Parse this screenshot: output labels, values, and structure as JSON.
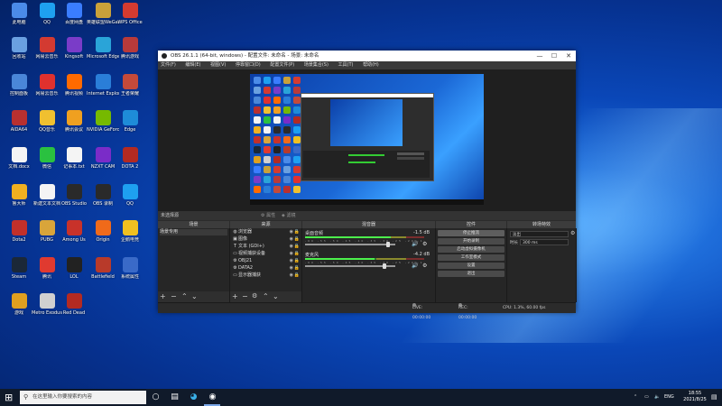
{
  "desktop": {
    "icons": [
      {
        "label": "此电脑",
        "color": "#4b8be8"
      },
      {
        "label": "QQ",
        "color": "#1ea0f0"
      },
      {
        "label": "百度网盘",
        "color": "#3a7dff"
      },
      {
        "label": "英雄联盟WeGame",
        "color": "#c9a13a"
      },
      {
        "label": "WPS Office",
        "color": "#d43b30"
      },
      {
        "label": "回收站",
        "color": "#6aa0e0"
      },
      {
        "label": "网易云音乐",
        "color": "#d33a31"
      },
      {
        "label": "Kingsoft",
        "color": "#7a3cc8"
      },
      {
        "label": "Microsoft Edge",
        "color": "#2aa4d8"
      },
      {
        "label": "腾讯游戏",
        "color": "#b83a3a"
      },
      {
        "label": "控制面板",
        "color": "#4a86d8"
      },
      {
        "label": "网易云音乐",
        "color": "#e0312e"
      },
      {
        "label": "腾讯视频",
        "color": "#ff6a00"
      },
      {
        "label": "Internet Explorer",
        "color": "#2a7ed8"
      },
      {
        "label": "王者荣耀",
        "color": "#c44a3a"
      },
      {
        "label": "AIDA64",
        "color": "#b83030"
      },
      {
        "label": "QQ音乐",
        "color": "#f0c030"
      },
      {
        "label": "腾讯会议",
        "color": "#f0a020"
      },
      {
        "label": "NVIDIA GeForce",
        "color": "#76b900"
      },
      {
        "label": "Edge",
        "color": "#1e8cd8"
      },
      {
        "label": "文档.docx",
        "color": "#f4f4f4"
      },
      {
        "label": "微信",
        "color": "#2ac140"
      },
      {
        "label": "记事本.txt",
        "color": "#f4f4f4"
      },
      {
        "label": "NZXT CAM",
        "color": "#7a2cc8"
      },
      {
        "label": "DOTA 2",
        "color": "#b32a22"
      },
      {
        "label": "鲁大师",
        "color": "#f0b020"
      },
      {
        "label": "新建文本文档",
        "color": "#f4f4f4"
      },
      {
        "label": "OBS Studio",
        "color": "#2a2a2a"
      },
      {
        "label": "OBS 录制",
        "color": "#2a2a2a"
      },
      {
        "label": "QQ",
        "color": "#1ea0f0"
      },
      {
        "label": "Dota2",
        "color": "#c2302a"
      },
      {
        "label": "PUBG",
        "color": "#d9a53a"
      },
      {
        "label": "Among Us",
        "color": "#c8322a"
      },
      {
        "label": "Origin",
        "color": "#f06a1a"
      },
      {
        "label": "企鹅电竞",
        "color": "#f0c020"
      },
      {
        "label": "Steam",
        "color": "#1b2838"
      },
      {
        "label": "腾讯",
        "color": "#e03a30"
      },
      {
        "label": "LOL",
        "color": "#222222"
      },
      {
        "label": "Battlefield",
        "color": "#b83a2a"
      },
      {
        "label": "系统属性",
        "color": "#3a6ac8"
      },
      {
        "label": "游戏",
        "color": "#e0a020"
      },
      {
        "label": "Metro Exodus",
        "color": "#d0d0d0"
      },
      {
        "label": "Red Dead",
        "color": "#b32a22"
      }
    ]
  },
  "obs": {
    "title": "OBS 26.1.1 (64-bit, windows) - 配置文件: 未命名 - 场景: 未命名",
    "menu": [
      "文件(F)",
      "编辑(E)",
      "视图(V)",
      "停靠窗口(D)",
      "配置文件(P)",
      "场景集合(S)",
      "工具(T)",
      "帮助(H)"
    ],
    "scene_bar": {
      "label": "未选择源",
      "props": "属性",
      "filters": "滤镜"
    },
    "docks": {
      "scenes": {
        "header": "场景",
        "items": [
          "场景专用"
        ]
      },
      "sources": {
        "header": "来源",
        "items": [
          {
            "name": "浏览器",
            "icon": "globe-icon",
            "glyph": "◍"
          },
          {
            "name": "图像",
            "icon": "image-icon",
            "glyph": "▣"
          },
          {
            "name": "文本 (GDI+)",
            "icon": "text-icon",
            "glyph": "T"
          },
          {
            "name": "视频捕获设备",
            "icon": "camera-icon",
            "glyph": "▭"
          },
          {
            "name": "OBJ21",
            "icon": "gear-icon",
            "glyph": "⚙"
          },
          {
            "name": "DATA2",
            "icon": "gear-icon",
            "glyph": "⚙"
          },
          {
            "name": "显示器捕获",
            "icon": "monitor-icon",
            "glyph": "▭"
          }
        ]
      },
      "mixer": {
        "header": "混音器",
        "channels": [
          {
            "name": "桌面音频",
            "db": "-1.5 dB",
            "level": 0.72,
            "volume": 0.92
          },
          {
            "name": "麦克风",
            "db": "-4.2 dB",
            "level": 0.58,
            "volume": 0.88
          }
        ],
        "ticks": "-60 -55 -50 -45 -40 -35 -30 -25 -20 -15 -10 -5 0"
      },
      "transitions": {
        "header": "转场特效",
        "selected": "淡出",
        "duration_label": "时长",
        "duration_value": "300 ms"
      },
      "controls": {
        "header": "控件",
        "buttons": [
          "停止推流",
          "开始录制",
          "启动虚拟摄像机",
          "工作室模式",
          "设置",
          "退出"
        ]
      }
    },
    "status": {
      "live": "LIVE: 00:00:00",
      "rec": "REC: 00:00:00",
      "cpu": "CPU: 1.3%, 60.00 fps"
    }
  },
  "taskbar": {
    "search_placeholder": "在这里输入你要搜索的内容",
    "lang": "ENG",
    "time": "18:55",
    "date": "2021/8/25"
  }
}
